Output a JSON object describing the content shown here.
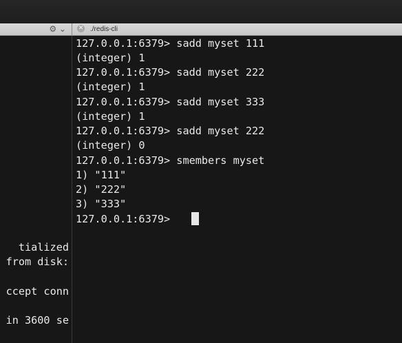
{
  "tabs": {
    "left_icons": "gear-icon",
    "right_close": "✕",
    "right_title": "./redis-cli"
  },
  "left_pane": {
    "lines": [
      "tialized",
      "from disk:",
      "",
      "ccept conn",
      "",
      "in 3600 se"
    ]
  },
  "terminal": {
    "lines": [
      "127.0.0.1:6379> sadd myset 111",
      "(integer) 1",
      "127.0.0.1:6379> sadd myset 222",
      "(integer) 1",
      "127.0.0.1:6379> sadd myset 333",
      "(integer) 1",
      "127.0.0.1:6379> sadd myset 222",
      "(integer) 0",
      "127.0.0.1:6379> smembers myset",
      "1) \"111\"",
      "2) \"222\"",
      "3) \"333\"",
      "127.0.0.1:6379> "
    ]
  }
}
